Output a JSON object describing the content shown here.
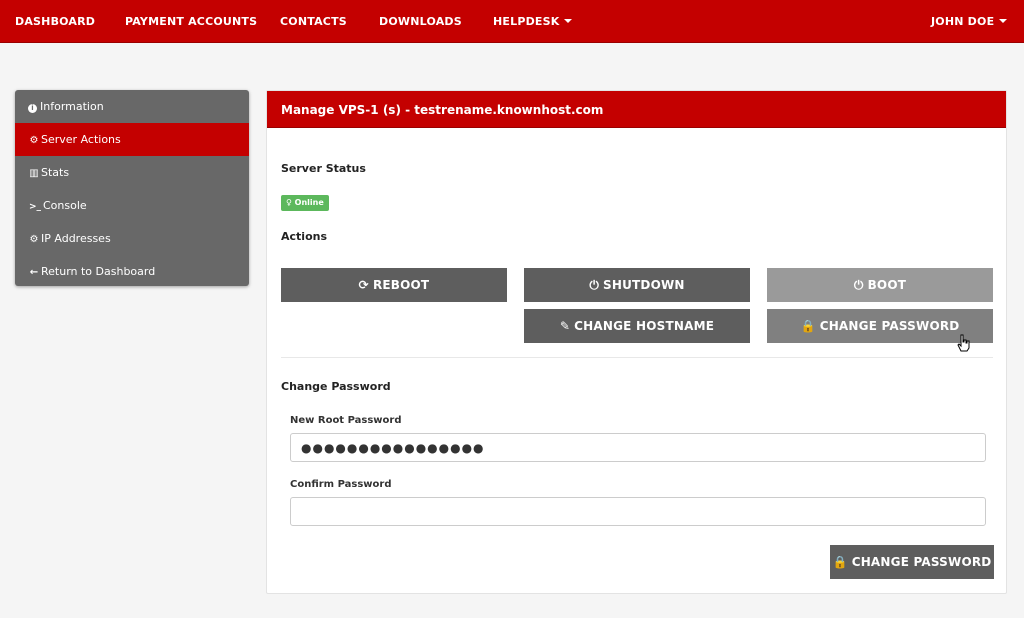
{
  "nav": {
    "items": [
      "DASHBOARD",
      "PAYMENT ACCOUNTS",
      "CONTACTS",
      "DOWNLOADS",
      "HELPDESK"
    ],
    "user": "JOHN DOE"
  },
  "sidebar": {
    "items": [
      {
        "icon": "info-circle-icon",
        "glyph": "i",
        "label": "Information"
      },
      {
        "icon": "cogs-icon",
        "glyph": "⚙",
        "label": "Server Actions",
        "active": true
      },
      {
        "icon": "bar-chart-icon",
        "glyph": "▥",
        "label": "Stats"
      },
      {
        "icon": "terminal-icon",
        "glyph": ">_",
        "label": "Console"
      },
      {
        "icon": "gear-icon",
        "glyph": "⚙",
        "label": "IP Addresses"
      },
      {
        "icon": "arrow-left-icon",
        "glyph": "←",
        "label": "Return to Dashboard"
      }
    ]
  },
  "panel": {
    "title": "Manage VPS-1 (s) - testrename.knownhost.com",
    "server_status_label": "Server Status",
    "status_badge": "Online",
    "actions_label": "Actions",
    "actions": {
      "reboot": "REBOOT",
      "shutdown": "SHUTDOWN",
      "boot": "BOOT",
      "change_hostname": "CHANGE HOSTNAME",
      "change_password": "CHANGE PASSWORD"
    },
    "change_password_section": "Change Password",
    "new_root_password_label": "New Root Password",
    "new_root_password_value": "●●●●●●●●●●●●●●●●",
    "confirm_password_label": "Confirm Password",
    "confirm_password_value": "",
    "submit_label": "CHANGE PASSWORD"
  },
  "colors": {
    "brand_red": "#c40000",
    "sidebar_gray": "#686868",
    "button_dark": "#5e5e5e",
    "button_light": "#9a9a9a",
    "status_green": "#5cb85c"
  }
}
